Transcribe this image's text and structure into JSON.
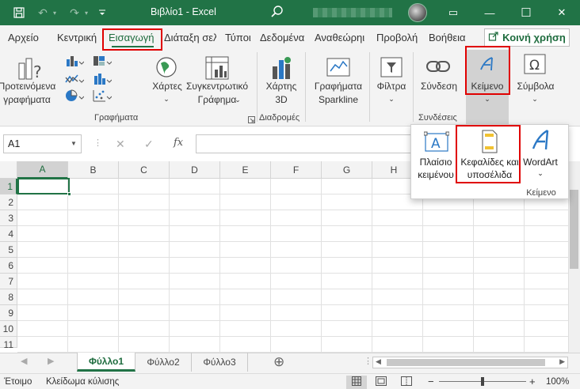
{
  "window": {
    "title": "Βιβλίο1 - Excel",
    "minimize_glyph": "—",
    "maximize_glyph": "☐",
    "close_glyph": "✕",
    "ribbon_display_glyph": "▭"
  },
  "tabs": [
    {
      "label": "Αρχείο"
    },
    {
      "label": "Κεντρική"
    },
    {
      "label": "Εισαγωγή"
    },
    {
      "label": "Διάταξη σελ"
    },
    {
      "label": "Τύποι"
    },
    {
      "label": "Δεδομένα"
    },
    {
      "label": "Αναθεώρηι"
    },
    {
      "label": "Προβολή"
    },
    {
      "label": "Βοήθεια"
    }
  ],
  "share_label": "Κοινή χρήση",
  "ribbon": {
    "recommended_charts": "Προτεινόμενα\nγραφήματα",
    "maps": "Χάρτες",
    "pivotchart": "Συγκεντρωτικό\nΓράφημα",
    "map3d": "Χάρτης\n3D",
    "sparklines": "Γραφήματα\nSparkline",
    "filters": "Φίλτρα",
    "link": "Σύνδεση",
    "text": "Κείμενο",
    "symbols": "Σύμβολα",
    "group_charts": "Γραφήματα",
    "group_tours": "Διαδρομές",
    "group_links": "Συνδέσεις"
  },
  "dropdown": {
    "textbox": "Πλαίσιο\nκειμένου",
    "header_footer": "Κεφαλίδες και\nυποσέλιδα",
    "wordart": "WordArt",
    "group_label": "Κείμενο"
  },
  "formula_bar": {
    "name_box": "A1",
    "cancel": "✕",
    "enter": "✓",
    "fx": "fx"
  },
  "columns": [
    "A",
    "B",
    "C",
    "D",
    "E",
    "F",
    "G",
    "H"
  ],
  "rows": [
    "1",
    "2",
    "3",
    "4",
    "5",
    "6",
    "7",
    "8",
    "9",
    "10",
    "11"
  ],
  "sheets": [
    "Φύλλο1",
    "Φύλλο2",
    "Φύλλο3"
  ],
  "add_sheet_glyph": "⊕",
  "status": {
    "ready": "Έτοιμο",
    "scroll_lock": "Κλείδωμα κύλισης",
    "zoom": "100%",
    "zoom_minus": "−",
    "zoom_plus": "+"
  },
  "accent": "#217346",
  "highlight": "#e00000"
}
